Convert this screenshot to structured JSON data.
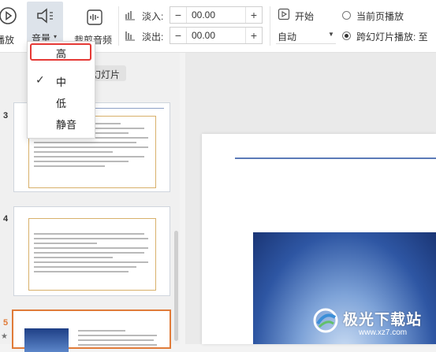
{
  "toolbar": {
    "play_label": "播放",
    "volume_label": "音量",
    "trim_label": "裁剪音频",
    "fade_in_label": "淡入:",
    "fade_in_value": "00.00",
    "fade_out_label": "淡出:",
    "fade_out_value": "00.00",
    "start_label": "开始",
    "start_mode_value": "自动",
    "current_page_play_label": "当前页播放",
    "cross_slide_play_label": "跨幻灯片播放: 至",
    "minus": "−",
    "plus": "+"
  },
  "volume_menu": {
    "items": [
      {
        "label": "高",
        "highlighted": true,
        "checked": false
      },
      {
        "label": "中",
        "highlighted": false,
        "checked": true
      },
      {
        "label": "低",
        "highlighted": false,
        "checked": false
      },
      {
        "label": "静音",
        "highlighted": false,
        "checked": false
      }
    ],
    "check_mark": "✓"
  },
  "slides_panel": {
    "partial_label": "幻灯片",
    "thumbnails": [
      {
        "number": "3",
        "selected": false
      },
      {
        "number": "4",
        "selected": false
      },
      {
        "number": "5",
        "selected": true
      }
    ],
    "star": "★"
  },
  "watermark": {
    "text": "极光下载站",
    "url": "www.xz7.com"
  },
  "colors": {
    "accent_orange": "#e07b39",
    "highlight_red": "#e53935",
    "slide_line_blue": "#5b7ab8"
  }
}
